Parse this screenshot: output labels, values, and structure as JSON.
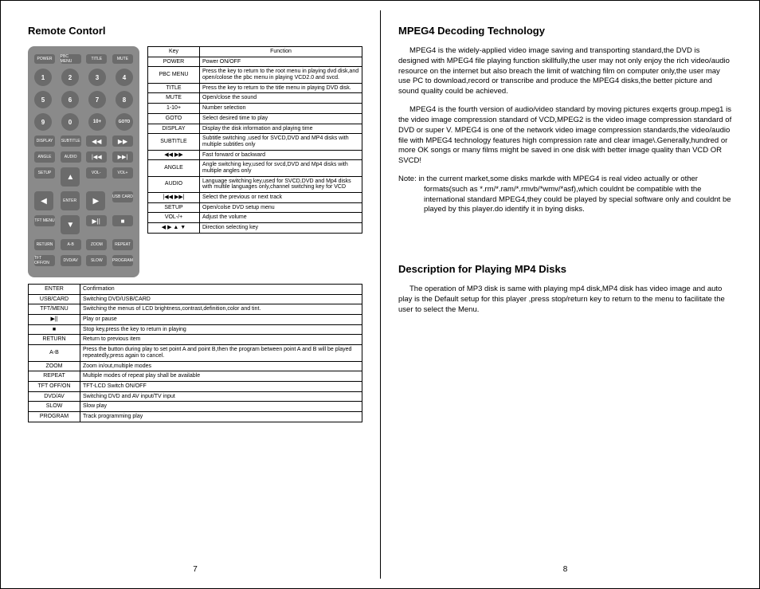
{
  "left": {
    "title": "Remote Contorl",
    "remote": {
      "row1": [
        "POWER",
        "PBC MENU",
        "TITLE",
        "MUTE"
      ],
      "row2": [
        "1",
        "2",
        "3",
        "4"
      ],
      "row3": [
        "5",
        "6",
        "7",
        "8"
      ],
      "row4": [
        "9",
        "0",
        "10+",
        "GOTO"
      ],
      "row5": [
        "DISPLAY",
        "SUBTITLE",
        "◀◀",
        "▶▶"
      ],
      "row6": [
        "ANGLE",
        "AUDIO",
        "|◀◀",
        "▶▶|"
      ],
      "row7": [
        "SETUP",
        "▲",
        "VOL-",
        "VOL+"
      ],
      "row8": [
        "◀",
        "ENTER",
        "▶",
        "USB CARD"
      ],
      "row9": [
        "TFT MENU",
        "▼",
        "▶||",
        "■"
      ],
      "row10": [
        "RETURN",
        "A-B",
        "ZOOM",
        "REPEAT"
      ],
      "row11": [
        "TFT OFF/ON",
        "DVD/AV",
        "SLOW",
        "PROGRAM"
      ]
    },
    "topTable": {
      "head": [
        "Key",
        "Function"
      ],
      "rows": [
        [
          "POWER",
          "Power ON/OFF"
        ],
        [
          "PBC MENU",
          "Press the key to return to the root menu in playing dvd disk,and open/colose the pbc menu in playing VCD2.0 and svcd."
        ],
        [
          "TITLE",
          "Press the key to return to the title menu in playing DVD disk."
        ],
        [
          "MUTE",
          "Open/close the sound"
        ],
        [
          "1-10+",
          "Number selection"
        ],
        [
          "GOTO",
          "Select desired time to play"
        ],
        [
          "DISPLAY",
          "Display the disk information and playing time"
        ],
        [
          "SUBTITLE",
          "Subtitle switching ,used for SVCD,DVD and MP4 disks with multiple subtitles only"
        ],
        [
          "◀◀  ▶▶",
          "Fast forward or backward"
        ],
        [
          "ANGLE",
          "Angle switching key,used for svcd,DVD and Mp4 disks with multiple angles only"
        ],
        [
          "AUDIO",
          "Language switching key,used for SVCD,DVD and Mp4 disks with multile languages only,channel switching key for VCD"
        ],
        [
          "|◀◀  ▶▶|",
          "Select the previous or next track"
        ],
        [
          "SETUP",
          "Open/colse DVD setup menu"
        ],
        [
          "VOL-/+",
          "Adjust the volume"
        ],
        [
          "◀ ▶ ▲ ▼",
          "Direction selecting key"
        ]
      ]
    },
    "bottomTable": {
      "rows": [
        [
          "ENTER",
          "Confirmation"
        ],
        [
          "USB/CARD",
          "Switching DVD/USB/CARD"
        ],
        [
          "TFT/MENU",
          "Switching the menus of LCD brightness,contrast,definition,color and tint."
        ],
        [
          "▶||",
          "Play or pause"
        ],
        [
          "■",
          "Stop key,press the key to return in playing"
        ],
        [
          "RETURN",
          "Return to previous item"
        ],
        [
          "A-B",
          "Press the button during play to set point A and point B,then the program between point A and B will be played repeatedly,press again to cancel."
        ],
        [
          "ZOOM",
          "Zoom in/out,multiple modes"
        ],
        [
          "REPEAT",
          "Multiple modes of repeat play shall be available"
        ],
        [
          "TFT OFF/ON",
          "TFT-LCD Switch ON/OFF"
        ],
        [
          "DVD/AV",
          "Switching DVD and AV input/TV input"
        ],
        [
          "SLOW",
          "Slow play"
        ],
        [
          "PROGRAM",
          "Track programming play"
        ]
      ]
    },
    "pageNum": "7"
  },
  "right": {
    "title1": "MPEG4 Decoding Technology",
    "p1": "MPEG4 is the widely-applied video image saving and transporting standard,the DVD is designed with MPEG4 file playing function skillfully,the user may not only enjoy the rich video/audio resource on the internet but also breach the limit of watching film on computer only,the user may use PC to download,record or transcribe and produce the MPEG4 disks,the better picture and sound quality could be achieved.",
    "p2": "MPEG4 is the fourth version of audio/video standard by moving pictures exqerts group.mpeg1 is the video image compression standard of VCD,MPEG2 is the video image compression standard of DVD or super V. MPEG4 is one of the network video image compression standards,the video/audio file with MPEG4 technology features high compression rate and clear image\\.Generally,hundred or more OK songs or many films might be saved in one disk with better image quality than VCD OR SVCD!",
    "noteLabel": "Note:",
    "p3": "in the current market,some disks markde with MPEG4 is real video actually or other formats(such as *.rm/*.ram/*.rmvb/*wmv/*asf),which couldnt be compatible with the international standard MPEG4,they could be played by special software only and couldnt be played by this player.do identify it in bying disks.",
    "title2": "Description for Playing MP4 Disks",
    "p4": "The operation of MP3 disk is same with playing mp4 disk,MP4 disk has video image and auto play is the Default setup for this player ,press stop/return key to return to the menu to facilitate the user to select the Menu.",
    "pageNum": "8"
  }
}
